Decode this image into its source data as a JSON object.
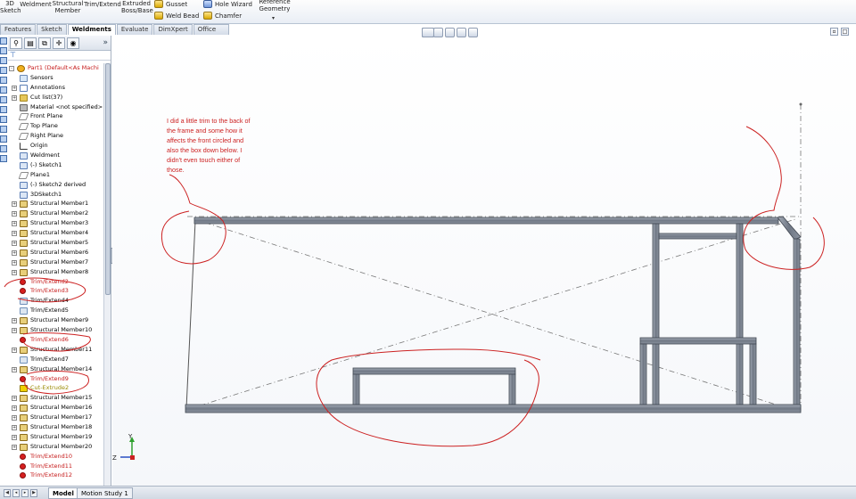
{
  "ribbon": {
    "sketch3d": "3D\nSketch",
    "weldment": "Weldment",
    "structural_member": "Structural\nMember",
    "trim_extend": "Trim/Extend",
    "extruded_boss": "Extruded\nBoss/Base",
    "gusset": "Gusset",
    "weld_bead": "Weld Bead",
    "hole_wizard": "Hole Wizard",
    "chamfer": "Chamfer",
    "reference_geometry": "Reference\nGeometry"
  },
  "tabs": [
    "Features",
    "Sketch",
    "Weldments",
    "Evaluate",
    "DimXpert",
    "Office Products"
  ],
  "active_tab": "Weldments",
  "tree": [
    {
      "label": "Part1  (Default<As Machi",
      "icon": "part",
      "level": 0,
      "exp": "-",
      "color": "red"
    },
    {
      "label": "Sensors",
      "icon": "sensor",
      "level": 1,
      "exp": ""
    },
    {
      "label": "Annotations",
      "icon": "ann",
      "level": 1,
      "exp": "+"
    },
    {
      "label": "Cut list(37)",
      "icon": "folder",
      "level": 1,
      "exp": "+"
    },
    {
      "label": "Material <not specified>",
      "icon": "mat",
      "level": 1,
      "exp": ""
    },
    {
      "label": "Front Plane",
      "icon": "plane",
      "level": 1,
      "exp": ""
    },
    {
      "label": "Top Plane",
      "icon": "plane",
      "level": 1,
      "exp": ""
    },
    {
      "label": "Right Plane",
      "icon": "plane",
      "level": 1,
      "exp": ""
    },
    {
      "label": "Origin",
      "icon": "origin",
      "level": 1,
      "exp": ""
    },
    {
      "label": "Weldment",
      "icon": "sketch",
      "level": 1,
      "exp": ""
    },
    {
      "label": "(-) Sketch1",
      "icon": "sketch",
      "level": 1,
      "exp": ""
    },
    {
      "label": "Plane1",
      "icon": "plane",
      "level": 1,
      "exp": ""
    },
    {
      "label": "(-) Sketch2 derived",
      "icon": "sketch",
      "level": 1,
      "exp": ""
    },
    {
      "label": "3DSketch1",
      "icon": "sketch",
      "level": 1,
      "exp": ""
    },
    {
      "label": "Structural Member1",
      "icon": "member",
      "level": 1,
      "exp": "+"
    },
    {
      "label": "Structural Member2",
      "icon": "member",
      "level": 1,
      "exp": "+"
    },
    {
      "label": "Structural Member3",
      "icon": "member",
      "level": 1,
      "exp": "+"
    },
    {
      "label": "Structural Member4",
      "icon": "member",
      "level": 1,
      "exp": "+"
    },
    {
      "label": "Structural Member5",
      "icon": "member",
      "level": 1,
      "exp": "+"
    },
    {
      "label": "Structural Member6",
      "icon": "member",
      "level": 1,
      "exp": "+"
    },
    {
      "label": "Structural Member7",
      "icon": "member",
      "level": 1,
      "exp": "+"
    },
    {
      "label": "Structural Member8",
      "icon": "member",
      "level": 1,
      "exp": "+"
    },
    {
      "label": "Trim/Extend2",
      "icon": "err",
      "level": 1,
      "exp": "",
      "color": "red"
    },
    {
      "label": "Trim/Extend3",
      "icon": "err",
      "level": 1,
      "exp": "",
      "color": "red"
    },
    {
      "label": "Trim/Extend4",
      "icon": "trim",
      "level": 1,
      "exp": ""
    },
    {
      "label": "Trim/Extend5",
      "icon": "trim",
      "level": 1,
      "exp": ""
    },
    {
      "label": "Structural Member9",
      "icon": "member",
      "level": 1,
      "exp": "+"
    },
    {
      "label": "Structural Member10",
      "icon": "member",
      "level": 1,
      "exp": "+"
    },
    {
      "label": "Trim/Extend6",
      "icon": "err",
      "level": 1,
      "exp": "",
      "color": "red"
    },
    {
      "label": "Structural Member11",
      "icon": "member",
      "level": 1,
      "exp": "+"
    },
    {
      "label": "Trim/Extend7",
      "icon": "trim",
      "level": 1,
      "exp": ""
    },
    {
      "label": "Structural Member14",
      "icon": "member",
      "level": 1,
      "exp": "+"
    },
    {
      "label": "Trim/Extend9",
      "icon": "err",
      "level": 1,
      "exp": "",
      "color": "red"
    },
    {
      "label": "Cut-Extrude2",
      "icon": "warn",
      "level": 1,
      "exp": "",
      "color": "yellow"
    },
    {
      "label": "Structural Member15",
      "icon": "member",
      "level": 1,
      "exp": "+"
    },
    {
      "label": "Structural Member16",
      "icon": "member",
      "level": 1,
      "exp": "+"
    },
    {
      "label": "Structural Member17",
      "icon": "member",
      "level": 1,
      "exp": "+"
    },
    {
      "label": "Structural Member18",
      "icon": "member",
      "level": 1,
      "exp": "+"
    },
    {
      "label": "Structural Member19",
      "icon": "member",
      "level": 1,
      "exp": "+"
    },
    {
      "label": "Structural Member20",
      "icon": "member",
      "level": 1,
      "exp": "+"
    },
    {
      "label": "Trim/Extend10",
      "icon": "err",
      "level": 1,
      "exp": "",
      "color": "red"
    },
    {
      "label": "Trim/Extend11",
      "icon": "err",
      "level": 1,
      "exp": "",
      "color": "red"
    },
    {
      "label": "Trim/Extend12",
      "icon": "err",
      "level": 1,
      "exp": "",
      "color": "red"
    }
  ],
  "annotation_note": "I did a little trim to the back of the frame and some how it affects the front circled and also the box down below. I didn't even touch either of those.",
  "bottom_tabs": [
    "Model",
    "Motion Study 1"
  ],
  "active_bottom_tab": "Model",
  "triad": {
    "y": "Y",
    "z": "Z"
  },
  "colors": {
    "annotation": "#cc2222",
    "frame": "#7d8592",
    "error": "#d61f1f",
    "accent": "#3a5c9a"
  }
}
